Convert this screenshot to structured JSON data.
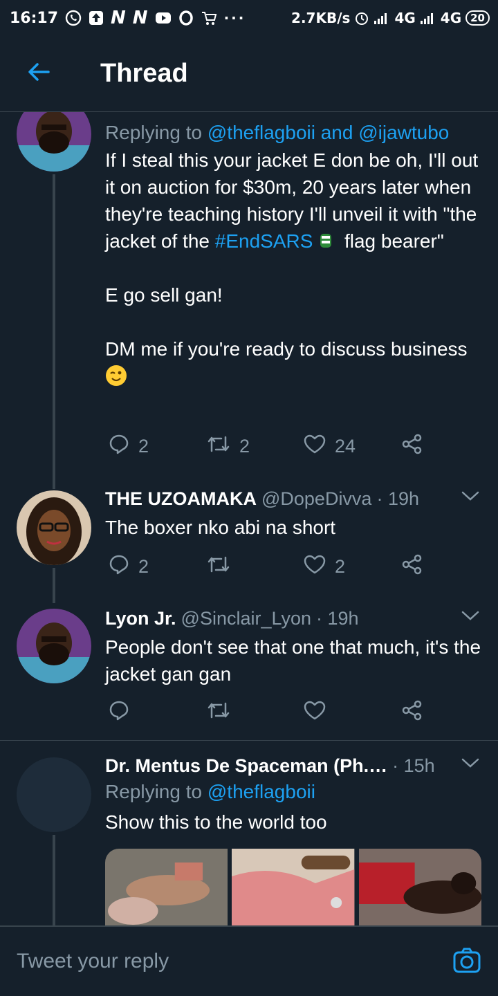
{
  "status_bar": {
    "time": "16:17",
    "speed": "2.7KB/s",
    "net1": "4G",
    "net2": "4G",
    "battery": "20"
  },
  "header": {
    "title": "Thread",
    "accent_color": "#1da1f2"
  },
  "tweets": [
    {
      "replying_label": "Replying to",
      "replying_to": "@theflagboii and @ijawtubo",
      "text_part1": "If I steal this your jacket E don be oh, I'll out it on auction for $30m, 20 years later when they're teaching history I'll unveil it with \"the jacket of the ",
      "hashtag": "#EndSARS",
      "text_part2": "  flag bearer\"\n\nE go sell gan!\n\nDM me if you're ready to discuss business ",
      "reply_count": "2",
      "retweet_count": "2",
      "like_count": "24"
    },
    {
      "name": "THE UZOAMAKA",
      "handle": "@DopeDivva",
      "time": "· 19h",
      "text": "The boxer nko abi na short",
      "reply_count": "2",
      "retweet_count": "",
      "like_count": "2"
    },
    {
      "name": "Lyon Jr.",
      "handle": "@Sinclair_Lyon",
      "time": "· 19h",
      "text": "People don't see that one that much, it's the jacket gan gan",
      "reply_count": "",
      "retweet_count": "",
      "like_count": ""
    },
    {
      "name": "Dr. Mentus De Spaceman (Ph.…",
      "time": "· 15h",
      "replying_label": "Replying to",
      "replying_to": "@theflagboii",
      "text": "Show this to the world too"
    }
  ],
  "reply_bar": {
    "placeholder": "Tweet your reply"
  },
  "icons": {
    "back": "arrow-left-icon",
    "reply": "comment-icon",
    "retweet": "retweet-icon",
    "like": "heart-icon",
    "share": "share-icon",
    "camera": "camera-icon",
    "caret": "chevron-down-icon"
  }
}
